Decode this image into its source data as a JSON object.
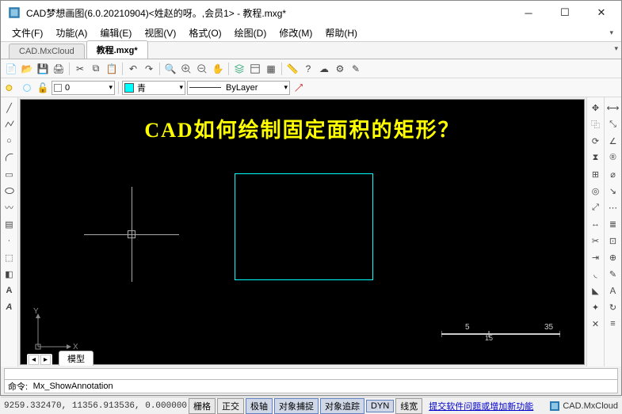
{
  "window": {
    "title": "CAD梦想画图(6.0.20210904)<姓赵的呀。,会员1> - 教程.mxg*"
  },
  "menu": {
    "items": [
      "文件(F)",
      "功能(A)",
      "编辑(E)",
      "视图(V)",
      "格式(O)",
      "绘图(D)",
      "修改(M)",
      "帮助(H)"
    ]
  },
  "tabs": {
    "items": [
      "CAD.MxCloud",
      "教程.mxg*"
    ],
    "activeIndex": 1
  },
  "layer": {
    "current": "0"
  },
  "color": {
    "current": "青"
  },
  "linetype": {
    "current": "ByLayer"
  },
  "canvas": {
    "headline": "CAD如何绘制固定面积的矩形？",
    "scale": {
      "left": "5",
      "right": "35",
      "mid": "15"
    },
    "ucs": {
      "x": "X",
      "y": "Y"
    },
    "modelTab": "模型"
  },
  "cmd": {
    "prompt": "命令:",
    "text": "Mx_ShowAnnotation"
  },
  "status": {
    "coords": "9259.332470, 11356.913536, 0.000000",
    "toggles": [
      {
        "label": "栅格",
        "on": false
      },
      {
        "label": "正交",
        "on": false
      },
      {
        "label": "极轴",
        "on": true
      },
      {
        "label": "对象捕捉",
        "on": true
      },
      {
        "label": "对象追踪",
        "on": true
      },
      {
        "label": "DYN",
        "on": true
      },
      {
        "label": "线宽",
        "on": false
      }
    ],
    "link": "提交软件问题或增加新功能",
    "brand": "CAD.MxCloud"
  }
}
